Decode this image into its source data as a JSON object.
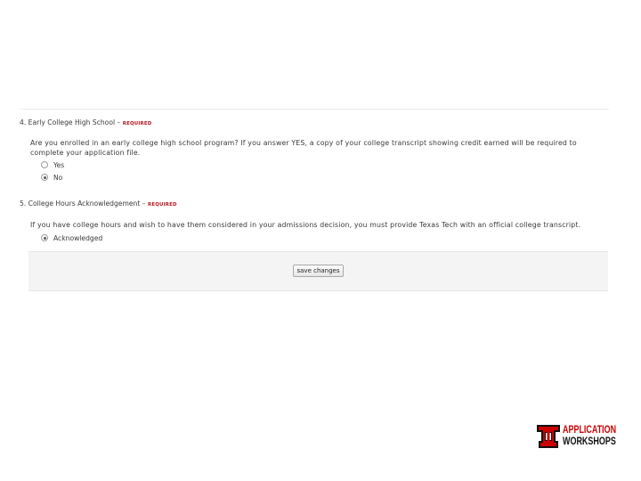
{
  "question4": {
    "number": "4.",
    "title": "Early College High School",
    "dash": "–",
    "required": "REQUIRED",
    "text_line1": "Are you enrolled in an early college high school program? If you answer YES, a copy of your college transcript showing credit earned will be required to",
    "text_line2": "complete your application file.",
    "options": [
      {
        "label": "Yes",
        "checked": false
      },
      {
        "label": "No",
        "checked": true
      }
    ]
  },
  "question5": {
    "number": "5.",
    "title": "College Hours Acknowledgement",
    "dash": "–",
    "required": "REQUIRED",
    "text": "If you have college hours and wish to have them considered in your admissions decision, you must provide Texas Tech with an official college transcript.",
    "options": [
      {
        "label": "Acknowledged",
        "checked": true
      }
    ]
  },
  "actions": {
    "save_label": "save changes"
  },
  "logo": {
    "line1": "APPLICATION",
    "line2": "WORKSHOPS",
    "colors": {
      "red": "#cc0000",
      "black": "#111111"
    }
  }
}
